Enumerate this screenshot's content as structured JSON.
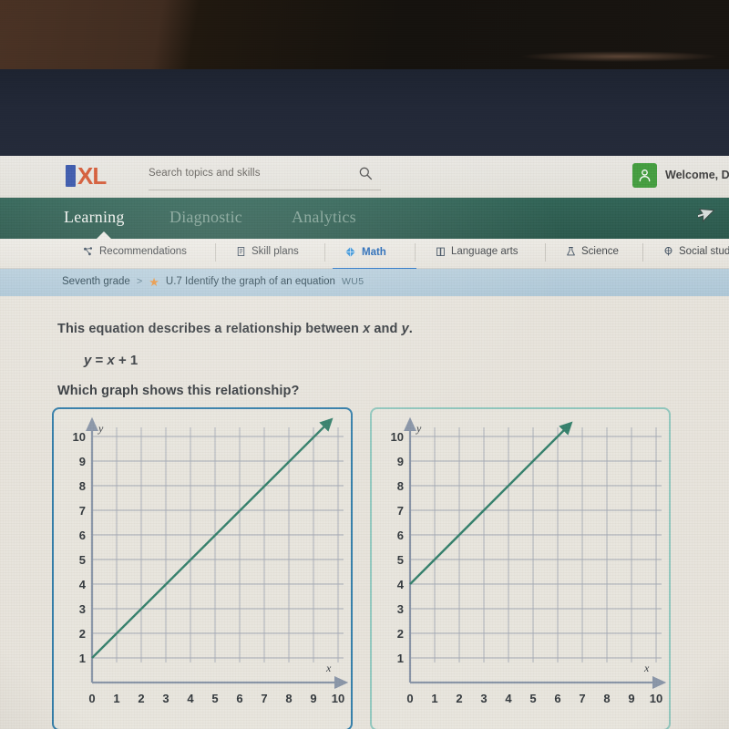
{
  "header": {
    "logo_i": "I",
    "logo_xl": "XL",
    "search_placeholder": "Search topics and skills",
    "search_value": "",
    "welcome_text": "Welcome, D",
    "avatar_icon": "user-icon"
  },
  "mainnav": {
    "items": [
      {
        "label": "Learning",
        "active": true
      },
      {
        "label": "Diagnostic",
        "active": false
      },
      {
        "label": "Analytics",
        "active": false
      }
    ]
  },
  "subnav": {
    "tabs": [
      {
        "label": "Recommendations",
        "icon": "recommendations-icon",
        "active": false
      },
      {
        "label": "Skill plans",
        "icon": "skill-plans-icon",
        "active": false
      },
      {
        "label": "Math",
        "icon": "math-icon",
        "active": true
      },
      {
        "label": "Language arts",
        "icon": "language-arts-icon",
        "active": false
      },
      {
        "label": "Science",
        "icon": "science-icon",
        "active": false
      },
      {
        "label": "Social stud",
        "icon": "social-studies-icon",
        "active": false
      }
    ]
  },
  "breadcrumb": {
    "grade": "Seventh grade",
    "separator": ">",
    "star_icon": "star-icon",
    "skill": "U.7 Identify the graph of an equation",
    "code": "WU5"
  },
  "question": {
    "line1_a": "This equation describes a relationship between ",
    "line1_x": "x",
    "line1_and": " and ",
    "line1_y": "y",
    "line1_end": ".",
    "equation_y": "y",
    "equation_eq": " = ",
    "equation_x": "x",
    "equation_plus": " + 1",
    "prompt": "Which graph shows this relationship?"
  },
  "colors": {
    "line": "#2f7d68",
    "axis": "#6b6f78",
    "grid": "#9aa0ab",
    "card_selected_border": "#2e7ba8",
    "card_border": "#8fc7bd",
    "nav_green": "#27594c",
    "tab_active": "#1f6fc4",
    "avatar_green": "#3f9b3a",
    "logo_blue": "#2f4fa8",
    "logo_orange": "#d3522c"
  },
  "chart_data": [
    {
      "id": "option-a",
      "type": "line",
      "title": "",
      "xlabel": "x",
      "ylabel": "y",
      "xlim": [
        0,
        10
      ],
      "ylim": [
        0,
        10
      ],
      "xticks": [
        "0",
        "1",
        "2",
        "3",
        "4",
        "5",
        "6",
        "7",
        "8",
        "9",
        "10"
      ],
      "yticks": [
        "1",
        "2",
        "3",
        "4",
        "5",
        "6",
        "7",
        "8",
        "9",
        "10"
      ],
      "grid": true,
      "selected": true,
      "series": [
        {
          "name": "y = x + 1",
          "slope": 1,
          "intercept": 1,
          "x": [
            0,
            9.5
          ],
          "y": [
            1,
            10.5
          ],
          "arrow_end": true
        }
      ]
    },
    {
      "id": "option-b",
      "type": "line",
      "title": "",
      "xlabel": "x",
      "ylabel": "y",
      "xlim": [
        0,
        10
      ],
      "ylim": [
        0,
        10
      ],
      "xticks": [
        "0",
        "1",
        "2",
        "3",
        "4",
        "5",
        "6",
        "7",
        "8",
        "9",
        "10"
      ],
      "yticks": [
        "1",
        "2",
        "3",
        "4",
        "5",
        "6",
        "7",
        "8",
        "9",
        "10"
      ],
      "grid": true,
      "selected": false,
      "series": [
        {
          "name": "y = x + 4",
          "slope": 1,
          "intercept": 4,
          "x": [
            0,
            6.3
          ],
          "y": [
            4,
            10.3
          ],
          "arrow_end": true
        }
      ]
    }
  ]
}
